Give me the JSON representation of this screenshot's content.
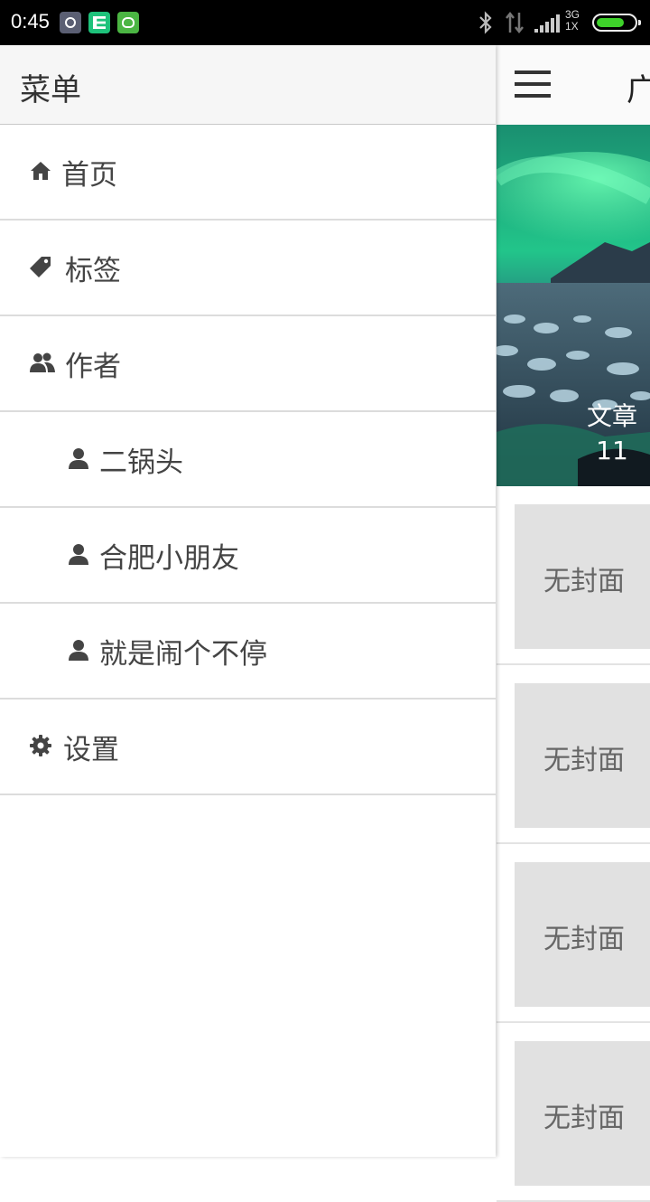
{
  "status_bar": {
    "time": "0:45",
    "network_top": "3G",
    "network_bottom": "1X"
  },
  "drawer": {
    "title": "菜单",
    "items": [
      {
        "label": "首页",
        "icon": "home-icon"
      },
      {
        "label": "标签",
        "icon": "tag-icon"
      },
      {
        "label": "作者",
        "icon": "users-icon"
      },
      {
        "label": "二锅头",
        "icon": "user-icon"
      },
      {
        "label": "合肥小朋友",
        "icon": "user-icon"
      },
      {
        "label": "就是闹个不停",
        "icon": "user-icon"
      },
      {
        "label": "设置",
        "icon": "gear-icon"
      }
    ]
  },
  "main": {
    "title": "广",
    "hero": {
      "caption_label": "文章",
      "caption_count": "11"
    },
    "cards": [
      {
        "cover_text": "无封面"
      },
      {
        "cover_text": "无封面"
      },
      {
        "cover_text": "无封面"
      },
      {
        "cover_text": "无封面"
      }
    ]
  },
  "colors": {
    "status_bar": "#000000",
    "battery_fill": "#3ed22a",
    "icon": "#444444",
    "placeholder_cover": "#e1e1e1"
  }
}
